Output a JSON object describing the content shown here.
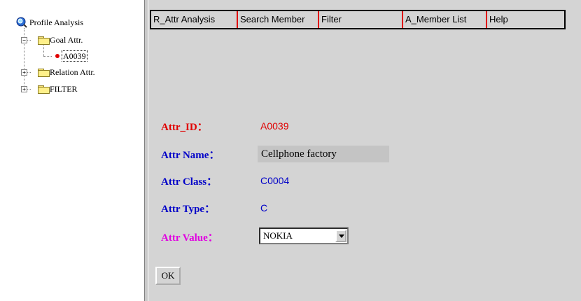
{
  "tree": {
    "root_label": "Profile Analysis",
    "items": [
      {
        "label": "Goal Attr.",
        "expander": "−",
        "children": [
          {
            "label": "A0039"
          }
        ]
      },
      {
        "label": "Relation Attr.",
        "expander": "+"
      },
      {
        "label": "FILTER",
        "expander": "+"
      }
    ]
  },
  "menu": [
    "R_Attr Analysis",
    "Search Member",
    "Filter",
    "A_Member List",
    "Help"
  ],
  "form": {
    "attr_id": {
      "label": "Attr_ID：",
      "value": "A0039"
    },
    "attr_name": {
      "label": "Attr Name：",
      "value": "Cellphone factory"
    },
    "attr_class": {
      "label": "Attr Class：",
      "value": "C0004"
    },
    "attr_type": {
      "label": "Attr Type：",
      "value": "C"
    },
    "attr_value": {
      "label": "Attr Value：",
      "selected": "NOKIA"
    },
    "ok_label": "OK"
  },
  "colors": {
    "id_color": "#e00000",
    "label_blue": "#0000c8",
    "value_label_color": "#e000e0",
    "menu_separator": "#e00000"
  }
}
